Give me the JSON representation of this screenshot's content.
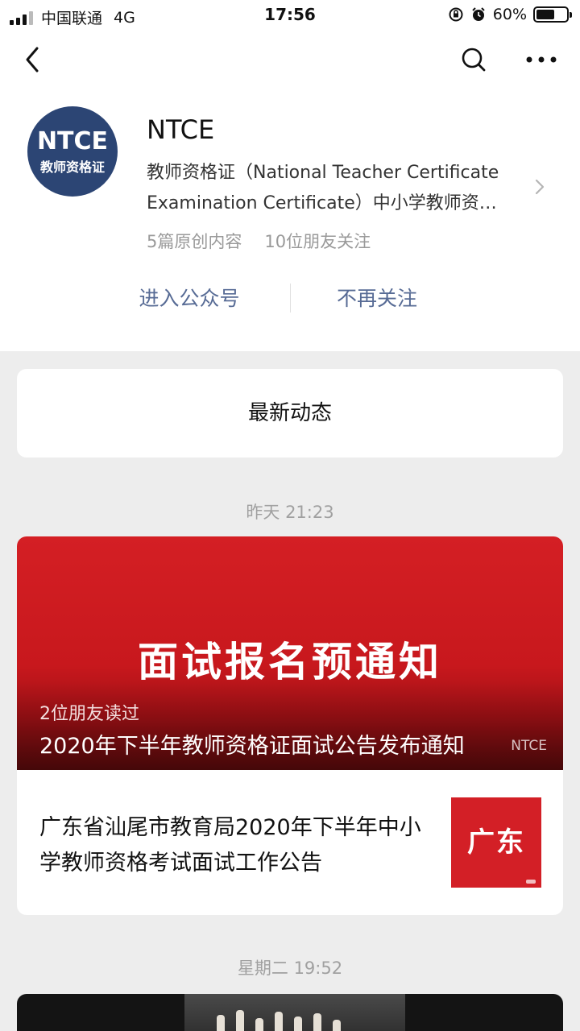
{
  "status_bar": {
    "carrier": "中国联通",
    "network": "4G",
    "time": "17:56",
    "battery": "60%",
    "battery_level": 0.6
  },
  "nav": {
    "back_icon": "chevron-left-icon",
    "search_icon": "search-icon",
    "more_icon": "more-dots-icon"
  },
  "profile": {
    "avatar_text": "NTCE",
    "avatar_subtext": "教师资格证",
    "name": "NTCE",
    "description_line1": "教师资格证（National Teacher Certificate",
    "description_line2": "Examination Certificate）中小学教师资…",
    "original_count": "5篇原创内容",
    "friends_following": "10位朋友关注",
    "enter_button": "进入公众号",
    "unfollow_button": "不再关注"
  },
  "latest": {
    "label": "最新动态"
  },
  "timeline": [
    {
      "time": "昨天 21:23",
      "banner_headline": "面试报名预通知",
      "friends_read": "2位朋友读过",
      "title": "2020年下半年教师资格证面试公告发布通知",
      "watermark": "NTCE",
      "sub_article": {
        "title": "广东省汕尾市教育局2020年下半年中小学教师资格考试面试工作公告",
        "thumbnail_text": "广东"
      }
    },
    {
      "time": "星期二 19:52"
    }
  ],
  "colors": {
    "link_blue": "#576b95",
    "banner_red": "#d41f24",
    "avatar_navy": "#2c4574",
    "background": "#ededed"
  }
}
